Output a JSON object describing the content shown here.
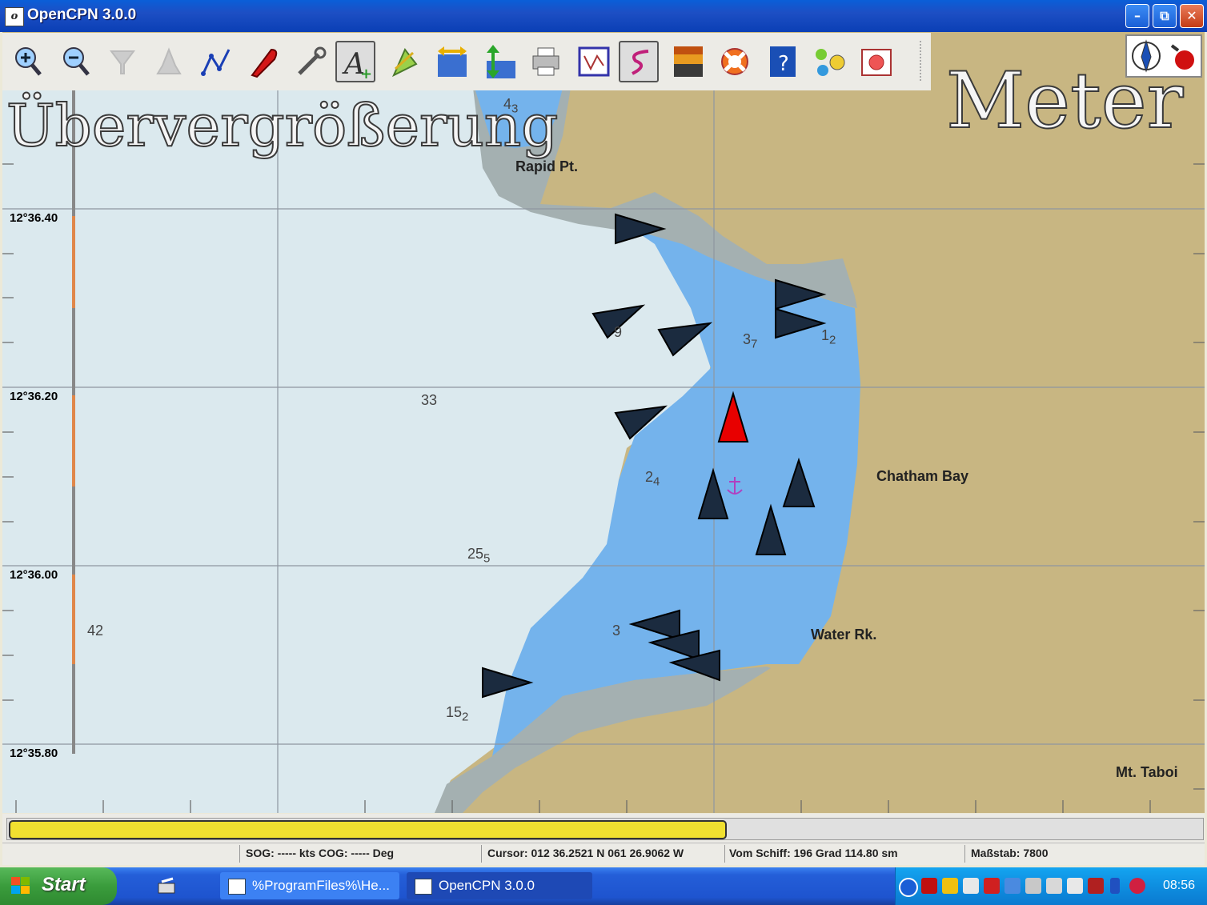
{
  "window": {
    "title": "OpenCPN 3.0.0",
    "app_icon": "opencpn-icon",
    "controls": [
      "minimize",
      "maximize",
      "close"
    ]
  },
  "toolbar": {
    "tools": [
      {
        "name": "zoom-in",
        "icon": "zoom-in-icon",
        "enabled": true
      },
      {
        "name": "zoom-out",
        "icon": "zoom-out-icon",
        "enabled": true
      },
      {
        "name": "scale-in",
        "icon": "funnel-icon",
        "enabled": false
      },
      {
        "name": "scale-out",
        "icon": "bell-icon",
        "enabled": false
      },
      {
        "name": "route",
        "icon": "route-icon",
        "enabled": true
      },
      {
        "name": "follow-ship",
        "icon": "boat-icon",
        "enabled": true
      },
      {
        "name": "settings",
        "icon": "wrench-icon",
        "enabled": true
      },
      {
        "name": "text",
        "icon": "text-icon",
        "enabled": true,
        "selected": true
      },
      {
        "name": "ais",
        "icon": "ais-icon",
        "enabled": true
      },
      {
        "name": "currents",
        "icon": "current-icon",
        "enabled": true
      },
      {
        "name": "tides",
        "icon": "tide-icon",
        "enabled": true
      },
      {
        "name": "print",
        "icon": "print-icon",
        "enabled": true
      },
      {
        "name": "route-manager",
        "icon": "route-manager-icon",
        "enabled": true
      },
      {
        "name": "track",
        "icon": "track-icon",
        "enabled": true,
        "selected": true
      },
      {
        "name": "color-scheme",
        "icon": "sunset-icon",
        "enabled": true
      },
      {
        "name": "mob",
        "icon": "lifebuoy-icon",
        "enabled": true
      },
      {
        "name": "help",
        "icon": "help-icon",
        "enabled": true
      },
      {
        "name": "instruments",
        "icon": "instruments-icon",
        "enabled": true
      },
      {
        "name": "about",
        "icon": "chart-icon",
        "enabled": true
      }
    ]
  },
  "chart": {
    "overzoom_label": "Übervergrößerung",
    "depth_unit_label": "Meter",
    "latitudes": [
      "12°36.40",
      "12°36.20",
      "12°36.00",
      "12°35.80"
    ],
    "places": {
      "rapid_pt": "Rapid Pt.",
      "chatham_bay": "Chatham Bay",
      "water_rk": "Water Rk.",
      "mt_taboi": "Mt. Taboi"
    },
    "soundings": [
      {
        "main": "4",
        "sub": "3"
      },
      {
        "main": "3",
        "sub": "7"
      },
      {
        "main": "1",
        "sub": "2"
      },
      {
        "main": "9",
        "sub": ""
      },
      {
        "main": "33",
        "sub": ""
      },
      {
        "main": "2",
        "sub": "4"
      },
      {
        "main": "25",
        "sub": "5"
      },
      {
        "main": "42",
        "sub": ""
      },
      {
        "main": "3",
        "sub": ""
      },
      {
        "main": "15",
        "sub": "2"
      }
    ],
    "colors": {
      "land": "#c8b682",
      "deep_water": "#dbe9ee",
      "shallow_water": "#74b3ec",
      "drying": "#a4b0b1",
      "ais_target": "#1b2b3f",
      "own_ship": "#e80000",
      "anchorage": "#b040c0"
    }
  },
  "progress": {
    "fraction": 0.6
  },
  "status": {
    "sog_cog": "SOG: ----- kts  COG: ----- Deg",
    "cursor": "Cursor: 012 36.2521 N 061 26.9062 W",
    "bearing": "Vom Schiff: 196 Grad  114.80 sm",
    "scale": "Maßstab:    7800"
  },
  "taskbar": {
    "start": "Start",
    "tasks": [
      {
        "label": "%ProgramFiles%\\He...",
        "icon": "folder-icon",
        "active": false
      },
      {
        "label": "OpenCPN 3.0.0",
        "icon": "opencpn-icon",
        "active": true
      }
    ],
    "clock": "08:56"
  }
}
